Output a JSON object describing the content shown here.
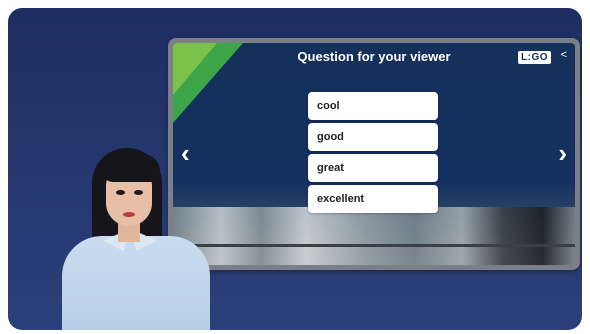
{
  "question": {
    "title": "Question for your viewer"
  },
  "logo": {
    "text": "L:GO"
  },
  "icons": {
    "share": "share-icon",
    "prev": "chevron-left-icon",
    "next": "chevron-right-icon"
  },
  "options": [
    {
      "label": "cool"
    },
    {
      "label": "good"
    },
    {
      "label": "great"
    },
    {
      "label": "excellent"
    }
  ],
  "colors": {
    "stage": "#26386f",
    "screen_frame": "#7b7f86",
    "accent_green": "#3da447"
  }
}
